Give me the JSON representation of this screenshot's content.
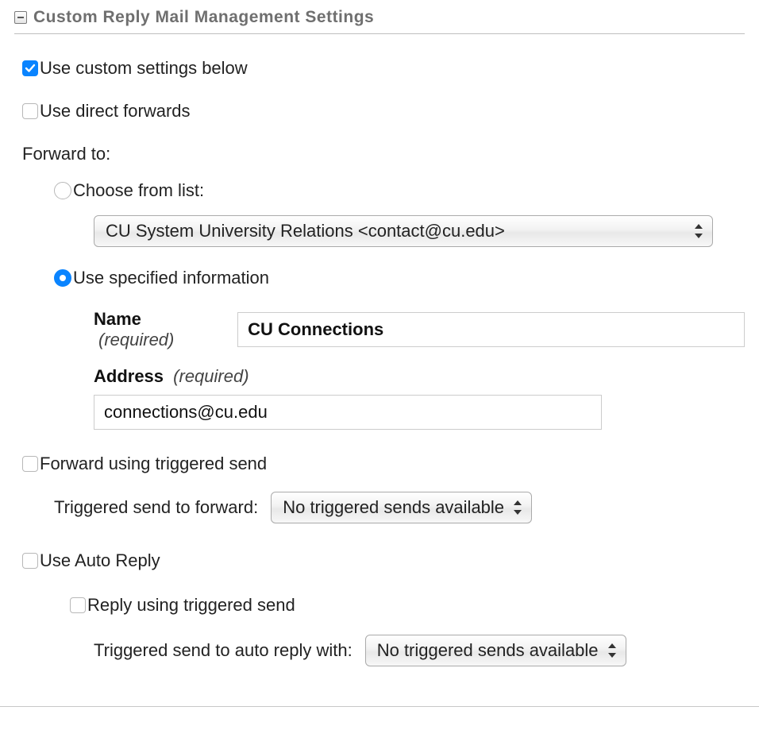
{
  "section": {
    "title": "Custom Reply Mail Management Settings"
  },
  "useCustom": {
    "label": "Use custom settings below",
    "checked": true
  },
  "useDirectForwards": {
    "label": "Use direct forwards",
    "checked": false
  },
  "forwardTo": {
    "label": "Forward to:",
    "chooseFromList": {
      "label": "Choose from list:",
      "selected": false,
      "selectValue": "CU System University Relations <contact@cu.edu>"
    },
    "useSpecified": {
      "label": "Use specified information",
      "selected": true,
      "nameLabel": "Name",
      "nameRequired": "(required)",
      "nameValue": "CU Connections",
      "addressLabel": "Address",
      "addressRequired": "(required)",
      "addressValue": "connections@cu.edu"
    }
  },
  "forwardTriggered": {
    "label": "Forward using triggered send",
    "checked": false,
    "sublabel": "Triggered send to forward:",
    "selectValue": "No triggered sends available"
  },
  "autoReply": {
    "label": "Use Auto Reply",
    "checked": false,
    "replyTriggered": {
      "label": "Reply using triggered send",
      "checked": false,
      "sublabel": "Triggered send to auto reply with:",
      "selectValue": "No triggered sends available"
    }
  }
}
